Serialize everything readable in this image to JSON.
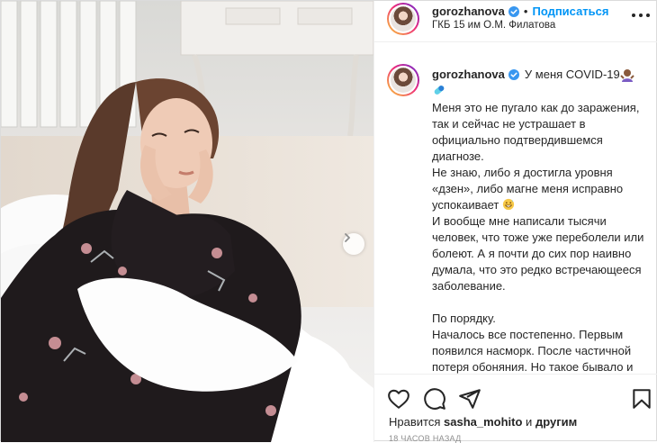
{
  "post": {
    "username": "gorozhanova",
    "separator": "•",
    "follow_label": "Подписаться",
    "location": "ГКБ 15 им О.М. Филатова",
    "caption": {
      "first_text": "У меня COVID-19",
      "emoji_1": "woman-shrugging",
      "emoji_2": "pill",
      "lines": [
        "Меня это не пугало как до заражения, так и сейчас не устрашает в официально подтвердившемся диагнозе.",
        "Не знаю, либо я достигла уровня «дзен», либо магне меня исправно успокаивает",
        "И вообще мне написали тысячи человек, что тоже уже переболели или болеют. А я почти до сих пор наивно думала, что это редко встречающееся заболевание.",
        "",
        "По порядку.",
        "Началось все постепенно. Первым появился насморк. После частичной потеря обоняния. Но такое бывало и при обычной простуде, поэтому"
      ],
      "emoji_3": "grinning-sweat"
    },
    "likes": {
      "prefix": "Нравится",
      "user": "sasha_mohito",
      "middle": "и",
      "others": "другим"
    },
    "timestamp": "18 часов назад"
  },
  "colors": {
    "accent": "#0095f6",
    "verified": "#3897f0",
    "text": "#262626",
    "muted": "#8e8e8e"
  }
}
